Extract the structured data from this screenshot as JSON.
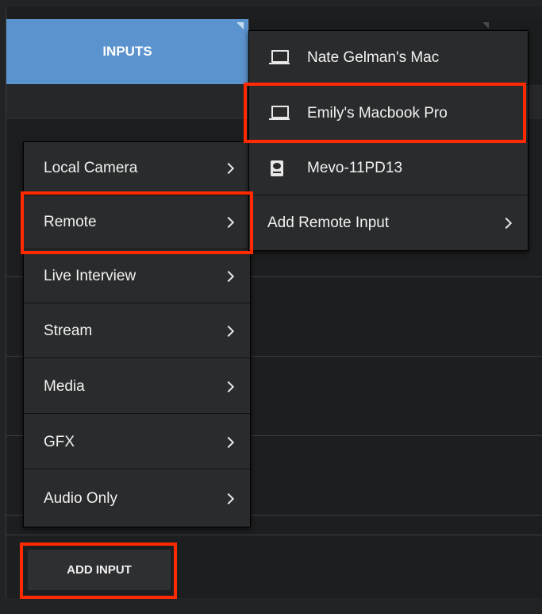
{
  "tabs": {
    "inputs_label": "INPUTS"
  },
  "main_menu": {
    "items": [
      {
        "label": "Local Camera"
      },
      {
        "label": "Remote"
      },
      {
        "label": "Live Interview"
      },
      {
        "label": "Stream"
      },
      {
        "label": "Media"
      },
      {
        "label": "GFX"
      },
      {
        "label": "Audio Only"
      }
    ]
  },
  "remote_submenu": {
    "items": [
      {
        "label": "Nate Gelman's Mac",
        "icon": "laptop-icon"
      },
      {
        "label": "Emily's Macbook Pro",
        "icon": "laptop-icon"
      },
      {
        "label": "Mevo-11PD13",
        "icon": "camera-icon"
      },
      {
        "label": "Add Remote Input"
      }
    ]
  },
  "footer": {
    "add_input_label": "ADD INPUT"
  },
  "colors": {
    "tab_active": "#5b93ce",
    "highlight": "#ff2a00",
    "menu_bg": "#2a2b2c",
    "panel_bg": "#1d1e1f"
  }
}
